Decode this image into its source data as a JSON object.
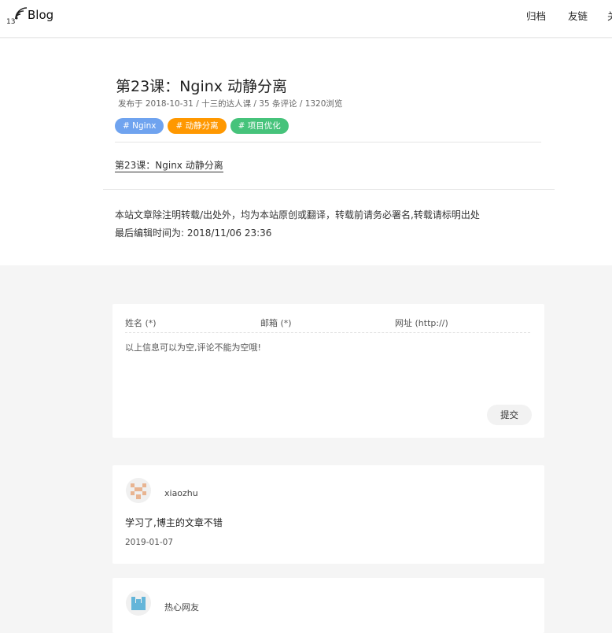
{
  "header": {
    "logo_number": "13",
    "logo_text": "Blog",
    "nav": [
      "归档",
      "友链",
      "关"
    ]
  },
  "article": {
    "title": "第23课：Nginx 动静分离",
    "meta": "发布于 2018-10-31 /  十三的达人课  /  35 条评论  / 1320浏览",
    "tags": [
      {
        "label": "# Nginx",
        "color": "#6fa3ef"
      },
      {
        "label": "# 动静分离",
        "color": "#ff9800"
      },
      {
        "label": "# 项目优化",
        "color": "#46c37b"
      }
    ],
    "link": "第23课：Nginx 动静分离",
    "notice": "本站文章除注明转载/出处外，均为本站原创或翻译，转载前请务必署名,转载请标明出处",
    "last_edit": "最后编辑时间为: 2018/11/06 23:36"
  },
  "comment_form": {
    "name_placeholder": "姓名 (*)",
    "email_placeholder": "邮箱 (*)",
    "url_placeholder": "网址 (http://)",
    "text_placeholder": "以上信息可以为空,评论不能为空哦!",
    "submit_label": "提交"
  },
  "comments": [
    {
      "author": "xiaozhu",
      "text": "学习了,博主的文章不错",
      "date": "2019-01-07",
      "avatar_color": "#e8b491"
    },
    {
      "author": "热心网友",
      "text": "",
      "date": "",
      "avatar_color": "#64b5d9"
    }
  ]
}
